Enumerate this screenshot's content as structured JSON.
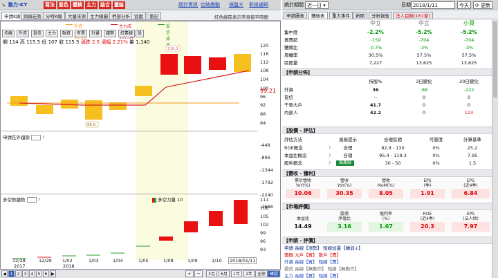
{
  "left_top": {
    "code_prefix": "↘",
    "stock_name": "動力-KY",
    "buttons": [
      "寫法",
      "股色",
      "體検",
      "主力",
      "論合",
      "靈論"
    ],
    "links": [
      "超計資訊",
      "空結變動",
      "操盤大",
      "彩投通知"
    ]
  },
  "left_tabs": [
    "申請K線",
    "跨線走勢",
    "分時K線",
    "大量來源",
    "主力線圖",
    "們部分析",
    "追蹤",
    "筆記"
  ],
  "slogan": "紅色線區表示常見報平時間",
  "legend": [
    {
      "text": "外資成本 93.08",
      "color": "#f39a1e"
    },
    {
      "text": "主力成本 107.34",
      "color": "#d61f1f"
    },
    {
      "text": "投信成本 --",
      "color": "#2a9a2a"
    }
  ],
  "period_buttons": [
    "均線",
    "外資",
    "投信",
    "主力",
    "融資",
    "有票",
    "計畫",
    "趨勢",
    "紅素線",
    "設"
  ],
  "ohlc": {
    "open_label": "開",
    "open": "114",
    "high_label": "高",
    "high": "115.5",
    "low_label": "低",
    "low": "107",
    "close_label": "收",
    "close": "115.5",
    "chg_label": "漲跌",
    "chg": "2.5",
    "pct_label": "漲幅",
    "pct": "2.21%",
    "vol_label": "量",
    "vol": "1,140"
  },
  "main_yaxis": [
    "120",
    "116",
    "112",
    "108",
    "104",
    "100",
    "96",
    "92",
    "88",
    "84"
  ],
  "price_marker": "99.21",
  "panel2": {
    "title": "申請在外趨勢",
    "yaxis": [
      "-448",
      "-896",
      "-1344",
      "-1792",
      "-2240",
      "-2688"
    ]
  },
  "panel3": {
    "title": "多空勢趨勢",
    "legend": "多空力量 10",
    "yaxis": [
      "111",
      "108",
      "105",
      "102",
      "99",
      "96",
      "93"
    ]
  },
  "x_dates": [
    {
      "text": "12/28",
      "year": "2017"
    },
    {
      "text": "12/29",
      "year": ""
    },
    {
      "text": "1/02",
      "year": "2018"
    },
    {
      "text": "1/03",
      "year": ""
    },
    {
      "text": "1/04",
      "year": ""
    },
    {
      "text": "1/05",
      "year": ""
    },
    {
      "text": "1/08",
      "year": ""
    },
    {
      "text": "1/09",
      "year": ""
    },
    {
      "text": "1/10",
      "year": ""
    },
    {
      "text": "2018/01/11",
      "year": ""
    }
  ],
  "high_marker": "116.5",
  "low_marker": "85.5",
  "bottom": {
    "pages": [
      "1",
      "2",
      "3",
      "4",
      "5",
      "6"
    ],
    "right": [
      "3月",
      "6月",
      "1年",
      "2年",
      "全部",
      "確認"
    ]
  },
  "right_top": {
    "label": "統計期間",
    "period": "近一日",
    "date_label": "日期",
    "date": "2018/1/11",
    "today": "今天",
    "refresh": "更新"
  },
  "right_tabs": [
    "申請圖表",
    "體檢表",
    "重大事件",
    "新聞",
    "分析報告",
    "法人目錄(161家)"
  ],
  "hdr_row": {
    "c1": "中立",
    "c2": "中立",
    "c3": "小買"
  },
  "stat_rows": [
    {
      "label": "集中度",
      "v1": "-2.2%",
      "v2": "-5.2%",
      "v3": "-5.2%"
    },
    {
      "label": "買賣超",
      "v1": "-159",
      "v2": "-704",
      "v3": "-704"
    },
    {
      "label": "體積比",
      "v1": "-0.7%",
      "v2": "-3%",
      "v3": "-3%"
    },
    {
      "label": "周轉率",
      "v1": "30.5%",
      "v2": "57.5%",
      "v3": "57.5%"
    },
    {
      "label": "區間量",
      "v1": "7,227",
      "v2": "13,625",
      "v3": "13,625"
    }
  ],
  "dist": {
    "title": "【申請分佈】",
    "headers": [
      "持股%",
      "3日變化",
      "20日變化"
    ],
    "rows": [
      {
        "label": "外資",
        "v1": "36",
        "v2": "-88",
        "v3": "-222"
      },
      {
        "label": "投信",
        "v1": "--",
        "v2": "0",
        "v3": "0"
      },
      {
        "label": "千張大戶",
        "v1": "41.7",
        "v2": "0",
        "v3": "0"
      },
      {
        "label": "內部人",
        "v1": "42.2",
        "v2": "0",
        "v3": "123"
      }
    ]
  },
  "valuation": {
    "title": "【股價 - 評估】",
    "headers": [
      "評估方法",
      "風險提示",
      "合理區間",
      "可靠度",
      "計算基準"
    ],
    "rows": [
      {
        "label": "ROE概念",
        "risk": "合理",
        "range": "82.9 - 130",
        "rel": "0%",
        "base": "25.2"
      },
      {
        "label": "本益比概念",
        "risk": "合理",
        "range": "95.4 - 119.3",
        "rel": "0%",
        "base": "7.95"
      },
      {
        "label": "股利概念",
        "risk": "高風險",
        "range": "30 - 50",
        "rel": "0%",
        "base": "1.5"
      }
    ]
  },
  "revenue": {
    "title": "【營收 - 獲利】",
    "headers": [
      "累計營收\nYoY(%)",
      "營收\nYoY(%)",
      "營收\nMoM(%)",
      "EPS\n(季)",
      "EPS\n(近4季)"
    ],
    "values": [
      "10.06",
      "30.35",
      "8.05",
      "1.91",
      "6.84"
    ]
  },
  "market": {
    "title": "【市場評價】",
    "headers": [
      "本益比",
      "股價\n淨值比",
      "殖利率\n(%)",
      "ROE\n(近4季)",
      "EPS\n(法人估)"
    ],
    "values": [
      "14.49",
      "3.16",
      "1.67",
      "20.3",
      "7.97"
    ]
  },
  "review": {
    "title": "【申請 - 評價】",
    "lines": [
      "申請 長線【漲勢】 短線加靈【轉弱↓】",
      "籌碼 大戶【買】 散戶【賣】",
      "外資 長線【買】 短線【賣】",
      "投信 長線【無動作】 短線【無動作】",
      "主力 長線【賣】 短線【賣】"
    ]
  }
}
